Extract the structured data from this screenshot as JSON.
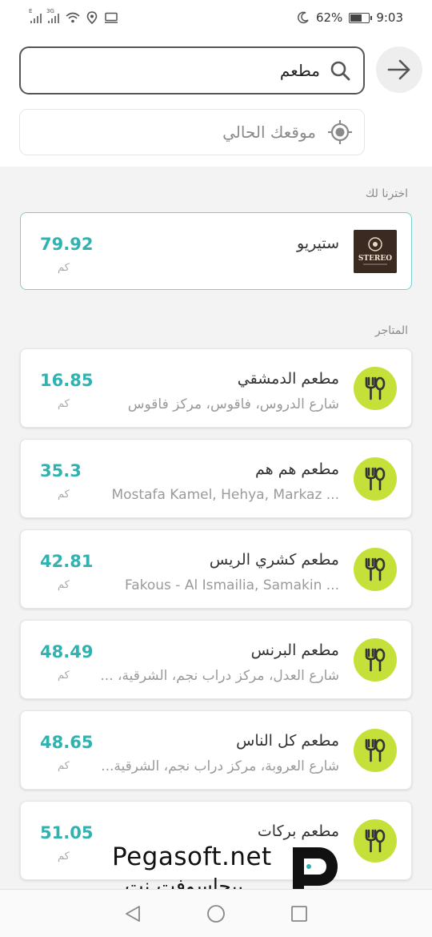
{
  "status_bar": {
    "signal_tag_1": "E",
    "signal_tag_2": "3G",
    "battery_percent": "62%",
    "time": "9:03"
  },
  "header": {
    "search_value": "مطعم",
    "location_placeholder": "موقعك الحالي"
  },
  "sections": {
    "featured_label": "اخترنا لك",
    "stores_label": "المتاجر"
  },
  "featured": {
    "name": "ستيريو",
    "distance": "79.92",
    "unit": "كم",
    "logo_text": "STEREO"
  },
  "stores": [
    {
      "name": "مطعم الدمشقي",
      "address": "شارع الدروس، فاقوس، مركز فاقوس",
      "distance": "16.85",
      "unit": "كم"
    },
    {
      "name": "مطعم هم هم",
      "address": "Mostafa Kamel, Hehya, Markaz ...",
      "distance": "35.3",
      "unit": "كم"
    },
    {
      "name": "مطعم كشري الريس",
      "address": "Fakous - Al Ismailia, Samakin ...",
      "distance": "42.81",
      "unit": "كم"
    },
    {
      "name": "مطعم البرنس",
      "address": "شارع العدل، مركز دراب نجم، الشرقية، ...",
      "distance": "48.49",
      "unit": "كم"
    },
    {
      "name": "مطعم كل الناس",
      "address": "شارع العروبة، مركز دراب نجم، الشرقية...",
      "distance": "48.65",
      "unit": "كم"
    },
    {
      "name": "مطعم بركات",
      "address": "",
      "distance": "51.05",
      "unit": "كم"
    }
  ],
  "watermark": {
    "line1": "Pegasoft.net",
    "line2": "بيجاسوفت.نت"
  },
  "colors": {
    "accent_teal": "#2fb2b0",
    "icon_lime": "#c6e03a"
  }
}
